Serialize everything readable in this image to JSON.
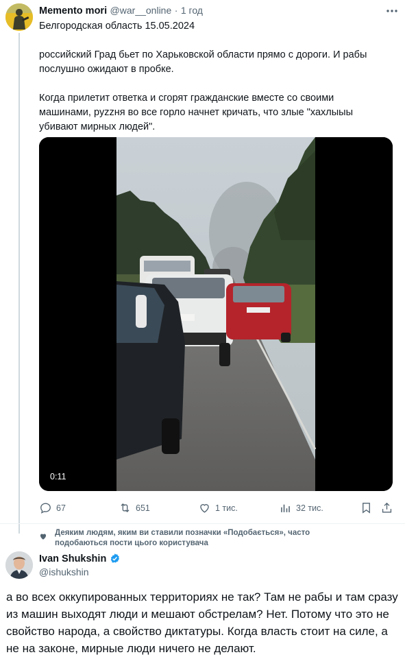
{
  "tweet1": {
    "author_name": "Memento mori",
    "handle": "@war__online",
    "separator": "·",
    "time": "1 год",
    "text_line1": "Белгородская область 15.05.2024",
    "text_para2": "российский Град бьет по Харьковской области прямо с дороги. И рабы послушно ожидают в пробке.",
    "text_para3": "Когда прилетит ответка и сгорят гражданские вместе со своими машинами, pyzzня во все горло начнет кричать, что злые \"хахлыыы убивают мирных людей\".",
    "video": {
      "duration": "0:11"
    },
    "actions": {
      "replies": "67",
      "reposts": "651",
      "likes": "1 тис.",
      "views": "32 тис."
    }
  },
  "social_context": "Деяким людям, яким ви ставили позначки «Подобається», часто подобаються пости цього користувача",
  "tweet2": {
    "author_name": "Ivan Shukshin",
    "handle": "@ishukshin",
    "text": "а во всех оккупированных территориях не так? Там не рабы и там сразу из машин выходят люди и мешают обстрелам? Нет. Потому что это не свойство народа, а свойство диктатуры. Когда власть стоит на силе, а не на законе, мирные люди ничего не делают."
  },
  "colors": {
    "accent": "#1d9bf0",
    "text": "#0f1419",
    "secondary": "#536471",
    "divider": "#eff3f4"
  },
  "icons": [
    "more-icon",
    "reply-icon",
    "repost-icon",
    "like-icon",
    "views-icon",
    "bookmark-icon",
    "share-icon",
    "heart-filled-icon",
    "verified-icon"
  ]
}
